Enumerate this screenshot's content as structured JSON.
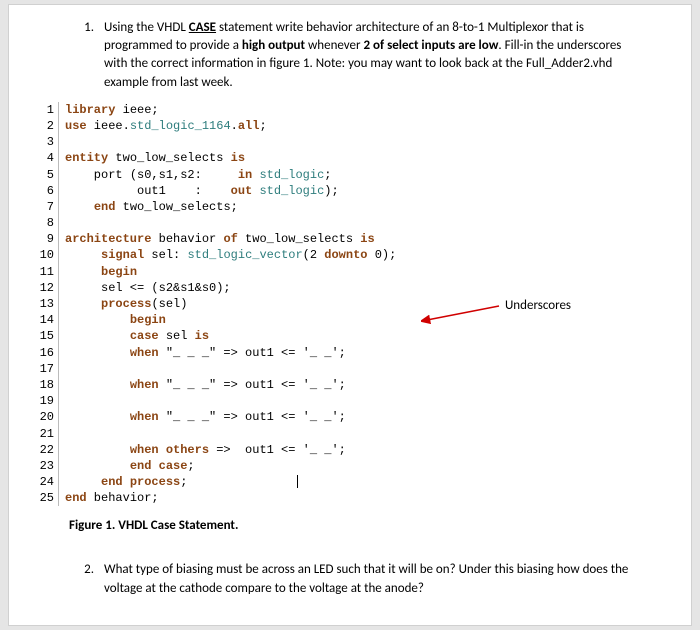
{
  "q1": {
    "num": "1.",
    "text_parts": [
      "Using the VHDL ",
      "CASE",
      " statement write behavior architecture of an 8-to-1 Multiplexor that is programmed to provide a ",
      "high output",
      " whenever ",
      "2 of select inputs are low",
      ". Fill-in the underscores with the correct information in figure 1. Note: you may want to look back at the Full_Adder2.vhd example from last week."
    ]
  },
  "code": [
    {
      "n": "1",
      "s": [
        [
          "library",
          "kw-brown"
        ],
        [
          " ieee;",
          "kw-dark"
        ]
      ]
    },
    {
      "n": "2",
      "s": [
        [
          "use",
          "kw-brown"
        ],
        [
          " ieee.",
          "kw-dark"
        ],
        [
          "std_logic_1164",
          "kw-teal"
        ],
        [
          ".",
          "kw-dark"
        ],
        [
          "all",
          "kw-brown"
        ],
        [
          ";",
          "kw-dark"
        ]
      ]
    },
    {
      "n": "3",
      "s": [
        [
          "",
          ""
        ]
      ]
    },
    {
      "n": "4",
      "s": [
        [
          "entity",
          "kw-brown"
        ],
        [
          " two_low_selects ",
          "kw-dark"
        ],
        [
          "is",
          "kw-brown"
        ]
      ]
    },
    {
      "n": "5",
      "s": [
        [
          "    port ",
          "kw-dark"
        ],
        [
          "(s0,s1,s2:     ",
          "kw-dark"
        ],
        [
          "in",
          "kw-brown"
        ],
        [
          " ",
          "kw-dark"
        ],
        [
          "std_logic",
          "kw-teal"
        ],
        [
          ";",
          "kw-dark"
        ]
      ]
    },
    {
      "n": "6",
      "s": [
        [
          "          out1    :    ",
          "kw-dark"
        ],
        [
          "out",
          "kw-brown"
        ],
        [
          " ",
          "kw-dark"
        ],
        [
          "std_logic",
          "kw-teal"
        ],
        [
          ");",
          "kw-dark"
        ]
      ]
    },
    {
      "n": "7",
      "s": [
        [
          "    ",
          "kw-dark"
        ],
        [
          "end",
          "kw-brown"
        ],
        [
          " two_low_selects;",
          "kw-dark"
        ]
      ]
    },
    {
      "n": "8",
      "s": [
        [
          "",
          ""
        ]
      ]
    },
    {
      "n": "9",
      "s": [
        [
          "architecture",
          "kw-brown"
        ],
        [
          " behavior ",
          "kw-dark"
        ],
        [
          "of",
          "kw-brown"
        ],
        [
          " two_low_selects ",
          "kw-dark"
        ],
        [
          "is",
          "kw-brown"
        ]
      ]
    },
    {
      "n": "10",
      "s": [
        [
          "     ",
          "kw-dark"
        ],
        [
          "signal",
          "kw-brown"
        ],
        [
          " sel: ",
          "kw-dark"
        ],
        [
          "std_logic_vector",
          "kw-teal"
        ],
        [
          "(2 ",
          "kw-dark"
        ],
        [
          "downto",
          "kw-brown"
        ],
        [
          " 0);",
          "kw-dark"
        ]
      ]
    },
    {
      "n": "11",
      "s": [
        [
          "     ",
          "kw-dark"
        ],
        [
          "begin",
          "kw-brown"
        ]
      ]
    },
    {
      "n": "12",
      "s": [
        [
          "     sel <= (s2&s1&s0);",
          "kw-dark"
        ]
      ]
    },
    {
      "n": "13",
      "s": [
        [
          "     ",
          "kw-dark"
        ],
        [
          "process",
          "kw-brown"
        ],
        [
          "(sel)",
          "kw-dark"
        ]
      ]
    },
    {
      "n": "14",
      "s": [
        [
          "         ",
          "kw-dark"
        ],
        [
          "begin",
          "kw-brown"
        ]
      ]
    },
    {
      "n": "15",
      "s": [
        [
          "         ",
          "kw-dark"
        ],
        [
          "case",
          "kw-brown"
        ],
        [
          " sel ",
          "kw-dark"
        ],
        [
          "is",
          "kw-brown"
        ]
      ]
    },
    {
      "n": "16",
      "s": [
        [
          "         ",
          "kw-dark"
        ],
        [
          "when",
          "kw-brown"
        ],
        [
          " \"_ _ _\" => out1 <= '_ _';",
          "kw-dark"
        ]
      ]
    },
    {
      "n": "17",
      "s": [
        [
          "",
          ""
        ]
      ]
    },
    {
      "n": "18",
      "s": [
        [
          "         ",
          "kw-dark"
        ],
        [
          "when",
          "kw-brown"
        ],
        [
          " \"_ _ _\" => out1 <= '_ _';",
          "kw-dark"
        ]
      ]
    },
    {
      "n": "19",
      "s": [
        [
          "",
          ""
        ]
      ]
    },
    {
      "n": "20",
      "s": [
        [
          "         ",
          "kw-dark"
        ],
        [
          "when",
          "kw-brown"
        ],
        [
          " \"_ _ _\" => out1 <= '_ _';",
          "kw-dark"
        ]
      ]
    },
    {
      "n": "21",
      "s": [
        [
          "",
          ""
        ]
      ]
    },
    {
      "n": "22",
      "s": [
        [
          "         ",
          "kw-dark"
        ],
        [
          "when others",
          "kw-brown"
        ],
        [
          " =>  out1 <= '_ _';",
          "kw-dark"
        ]
      ]
    },
    {
      "n": "23",
      "s": [
        [
          "         ",
          "kw-dark"
        ],
        [
          "end case",
          "kw-brown"
        ],
        [
          ";",
          "kw-dark"
        ]
      ]
    },
    {
      "n": "24",
      "s": [
        [
          "     ",
          "kw-dark"
        ],
        [
          "end process",
          "kw-brown"
        ],
        [
          ";",
          "kw-dark"
        ]
      ]
    },
    {
      "n": "25",
      "s": [
        [
          "end",
          "kw-brown"
        ],
        [
          " behavior;",
          "kw-dark"
        ]
      ]
    }
  ],
  "annotation": "Underscores",
  "caption": "Figure 1. VHDL Case Statement.",
  "q2": {
    "num": "2.",
    "text": "What type of biasing must be across an LED such that it will be on? Under this biasing how does the voltage at the cathode compare to the voltage at the anode?"
  }
}
